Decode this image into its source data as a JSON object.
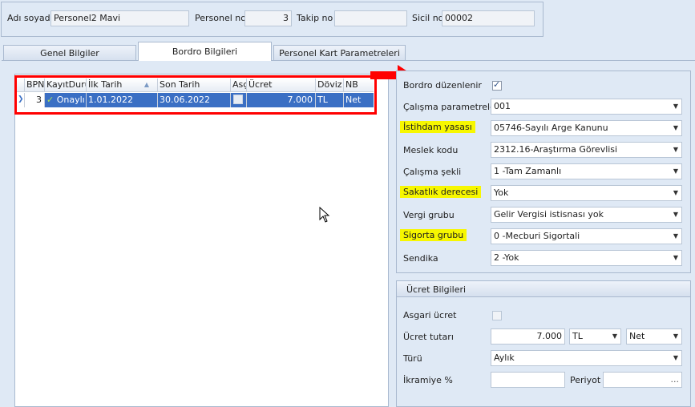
{
  "header": {
    "name_label": "Adı soyadı",
    "name_value": "Personel2 Mavi",
    "personel_no_label": "Personel no",
    "personel_no_value": "3",
    "takip_no_label": "Takip no",
    "takip_no_value": "",
    "sicil_no_label": "Sicil no",
    "sicil_no_value": "00002"
  },
  "tabs": [
    {
      "label": "Genel Bilgiler"
    },
    {
      "label": "Bordro Bilgileri"
    },
    {
      "label": "Personel Kart Parametreleri"
    }
  ],
  "grid": {
    "columns": [
      "BPN",
      "KayıtDurumu",
      "İlk Tarih",
      "Son Tarih",
      "Asgari",
      "Ücret",
      "Döviz",
      "NB"
    ],
    "header_texts": {
      "bpn": "BPN",
      "kayit": "KayıtDurum",
      "ilk": "İlk Tarih",
      "son": "Son Tarih",
      "asg": "Asç",
      "ucret": "Ücret",
      "doviz": "Döviz",
      "nb": "NB"
    },
    "row": {
      "bpn": "3",
      "kayit": "Onaylı",
      "ilk": "1.01.2022",
      "son": "30.06.2022",
      "ucret": "7.000",
      "doviz": "TL",
      "nb": "Net"
    }
  },
  "bordro": {
    "bordro_duzenlenir_label": "Bordro düzenlenir",
    "bordro_duzenlenir_checked": true,
    "calisma_param_label": "Çalışma parametreleri",
    "calisma_param_value": "001",
    "istihdam_label": "İstihdam yasası",
    "istihdam_value": "05746-Sayılı Arge Kanunu",
    "meslek_label": "Meslek kodu",
    "meslek_value": "2312.16-Araştırma Görevlisi",
    "calisma_sekli_label": "Çalışma şekli",
    "calisma_sekli_value": "1 -Tam Zamanlı",
    "sakatlik_label": "Sakatlık derecesi",
    "sakatlik_value": "Yok",
    "vergi_label": "Vergi grubu",
    "vergi_value": "Gelir Vergisi istisnası yok",
    "sigorta_label": "Sigorta grubu",
    "sigorta_value": "0 -Mecburi Sigortali",
    "sendika_label": "Sendika",
    "sendika_value": "2 -Yok"
  },
  "ucret": {
    "title": "Ücret Bilgileri",
    "asgari_label": "Asgari ücret",
    "asgari_checked": false,
    "tutar_label": "Ücret tutarı",
    "tutar_value": "7.000",
    "doviz_value": "TL",
    "net_value": "Net",
    "turu_label": "Türü",
    "turu_value": "Aylık",
    "ikramiye_label": "İkramiye %",
    "ikramiye_value": "",
    "periyot_label": "Periyot",
    "periyot_value": "",
    "ellipsis": "..."
  },
  "colors": {
    "highlight": "#f7f700",
    "annotation": "#ff0000",
    "selected_row": "#3a6fc4"
  }
}
